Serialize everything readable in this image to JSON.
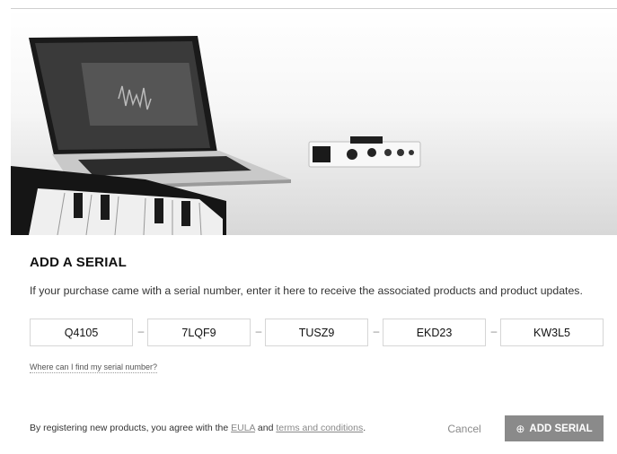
{
  "header": {
    "title": "ADD A SERIAL",
    "description": "If your purchase came with a serial number, enter it here to receive the associated products and product updates."
  },
  "serial": {
    "segments": [
      "Q4105",
      "7LQF9",
      "TUSZ9",
      "EKD23",
      "KW3L5"
    ],
    "separator": "–"
  },
  "help_link": "Where can I find my serial number?",
  "footer": {
    "prefix": "By registering new products, you agree with the ",
    "eula": "EULA",
    "and": " and ",
    "terms": "terms and conditions",
    "suffix": "."
  },
  "actions": {
    "cancel": "Cancel",
    "add": "ADD SERIAL",
    "add_icon": "plus-circle-icon"
  },
  "colors": {
    "button_bg": "#8a8a8a",
    "link": "#888888",
    "border": "#d6d6d6"
  }
}
